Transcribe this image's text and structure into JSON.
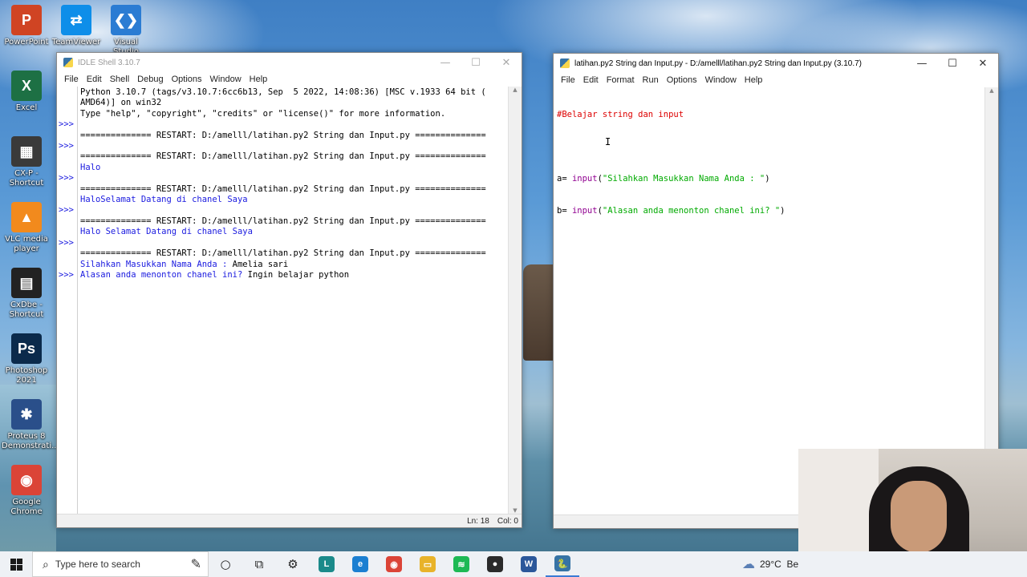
{
  "desktop": {
    "icons": [
      {
        "label": "PowerPoint",
        "glyph": "P",
        "color": "#d04423"
      },
      {
        "label": "TeamViewer",
        "glyph": "⇄",
        "color": "#0e8ee9"
      },
      {
        "label": "Visual Studio",
        "glyph": "❮❯",
        "color": "#2b7cd3"
      },
      {
        "label": "Excel",
        "glyph": "X",
        "color": "#1d7044"
      },
      {
        "label": "CX-P - Shortcut",
        "glyph": "▦",
        "color": "#3a3a3a"
      },
      {
        "label": "VLC media player",
        "glyph": "▲",
        "color": "#f28a1d"
      },
      {
        "label": "CxDbe - Shortcut",
        "glyph": "▤",
        "color": "#222222"
      },
      {
        "label": "Photoshop 2021",
        "glyph": "Ps",
        "color": "#0b2a4b"
      },
      {
        "label": "Proteus 8 Demonstrati...",
        "glyph": "✱",
        "color": "#2a4f8a"
      },
      {
        "label": "Google Chrome",
        "glyph": "◉",
        "color": "#db4437"
      }
    ]
  },
  "shell": {
    "title": "IDLE Shell 3.10.7",
    "menu": [
      "File",
      "Edit",
      "Shell",
      "Debug",
      "Options",
      "Window",
      "Help"
    ],
    "gutter": [
      "",
      "",
      "",
      ">>>",
      "",
      ">>>",
      "",
      "",
      ">>>",
      "",
      "",
      ">>>",
      "",
      "",
      ">>>",
      "",
      "",
      ">>>"
    ],
    "lines": [
      {
        "text": "Python 3.10.7 (tags/v3.10.7:6cc6b13, Sep  5 2022, 14:08:36) [MSC v.1933 64 bit (",
        "kind": "plain"
      },
      {
        "text": "AMD64)] on win32",
        "kind": "plain"
      },
      {
        "text": "Type \"help\", \"copyright\", \"credits\" or \"license()\" for more information.",
        "kind": "plain"
      },
      {
        "text": "",
        "kind": "plain"
      },
      {
        "text": "============== RESTART: D:/amelll/latihan.py2 String dan Input.py ==============",
        "kind": "plain"
      },
      {
        "text": "",
        "kind": "plain"
      },
      {
        "text": "============== RESTART: D:/amelll/latihan.py2 String dan Input.py ==============",
        "kind": "plain"
      },
      {
        "text": "Halo",
        "kind": "out"
      },
      {
        "text": "",
        "kind": "plain"
      },
      {
        "text": "============== RESTART: D:/amelll/latihan.py2 String dan Input.py ==============",
        "kind": "plain"
      },
      {
        "text": "HaloSelamat Datang di chanel Saya",
        "kind": "out"
      },
      {
        "text": "",
        "kind": "plain"
      },
      {
        "text": "============== RESTART: D:/amelll/latihan.py2 String dan Input.py ==============",
        "kind": "plain"
      },
      {
        "text": "Halo Selamat Datang di chanel Saya",
        "kind": "out"
      },
      {
        "text": "",
        "kind": "plain"
      },
      {
        "text": "============== RESTART: D:/amelll/latihan.py2 String dan Input.py ==============",
        "kind": "plain"
      },
      {
        "prompt": "Silahkan Masukkan Nama Anda : ",
        "answer": "Amelia sari",
        "kind": "io"
      },
      {
        "prompt": "Alasan anda menonton chanel ini? ",
        "answer": "Ingin belajar python",
        "kind": "io"
      }
    ],
    "status": {
      "ln": "Ln: 18",
      "col": "Col: 0"
    }
  },
  "editor": {
    "title": "latihan.py2 String dan Input.py - D:/amelll/latihan.py2 String dan Input.py (3.10.7)",
    "menu": [
      "File",
      "Edit",
      "Format",
      "Run",
      "Options",
      "Window",
      "Help"
    ],
    "code": {
      "comment": "#Belajar string dan input",
      "line_a": {
        "var": "a= ",
        "fn": "input",
        "open": "(",
        "str": "\"Silahkan Masukkan Nama Anda : \"",
        "close": ")"
      },
      "line_b": {
        "var": "b= ",
        "fn": "input",
        "open": "(",
        "str": "\"Alasan anda menonton chanel ini? \"",
        "close": ")"
      }
    }
  },
  "taskbar": {
    "search_placeholder": "Type here to search",
    "apps": [
      {
        "name": "cortana",
        "glyph": "○"
      },
      {
        "name": "task-view",
        "glyph": "⧉"
      },
      {
        "name": "settings",
        "glyph": "⚙"
      },
      {
        "name": "launcher-l",
        "glyph": "L",
        "color": "#1a8a8a"
      },
      {
        "name": "edge",
        "glyph": "e",
        "color": "#1b7fd1"
      },
      {
        "name": "chrome",
        "glyph": "◉",
        "color": "#db4437"
      },
      {
        "name": "file-explorer",
        "glyph": "▭",
        "color": "#e8b32a"
      },
      {
        "name": "spotify",
        "glyph": "≋",
        "color": "#1db954"
      },
      {
        "name": "media-app",
        "glyph": "●",
        "color": "#2a2a2a"
      },
      {
        "name": "word",
        "glyph": "W",
        "color": "#2b579a"
      },
      {
        "name": "python-idle",
        "glyph": "🐍",
        "color": "#3673a5"
      }
    ],
    "weather": {
      "temp": "29°C",
      "extra": "Be"
    }
  }
}
